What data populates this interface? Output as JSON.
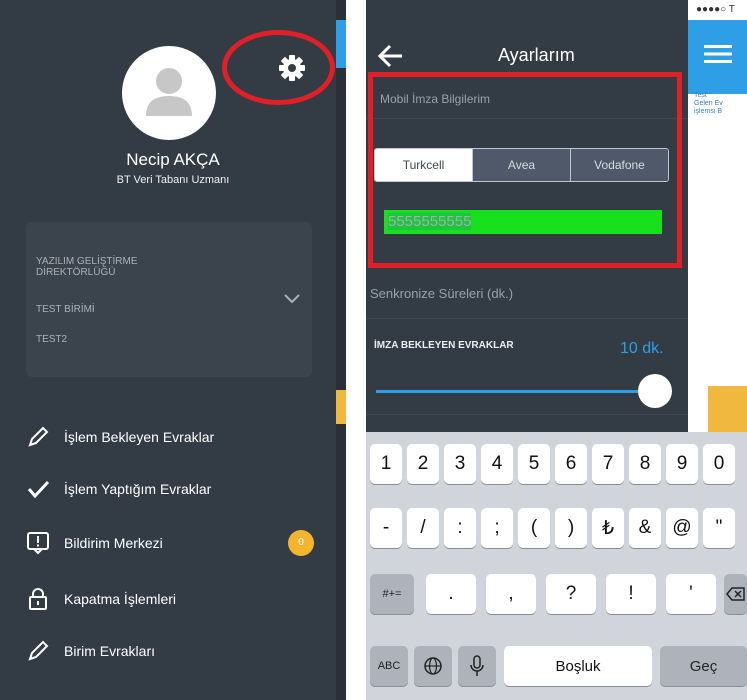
{
  "left_panel": {
    "user_name": "Necip AKÇA",
    "user_role": "BT Veri Tabanı Uzmanı",
    "units": [
      "YAZILIM GELİŞTİRME",
      "DİREKTÖRLÜĞÜ",
      "TEST BİRİMİ",
      "TEST2"
    ],
    "menu": [
      {
        "label": "İşlem Bekleyen Evraklar",
        "icon": "pencil-icon"
      },
      {
        "label": "İşlem Yaptığım Evraklar",
        "icon": "checkmark-icon"
      },
      {
        "label": "Bildirim Merkezi",
        "icon": "notification-icon"
      },
      {
        "label": "Kapatma İşlemleri",
        "icon": "lock-icon"
      },
      {
        "label": "Birim Evrakları",
        "icon": "pencil-icon"
      }
    ],
    "badge_count": "0"
  },
  "settings": {
    "title": "Ayarlarım",
    "mobile_sig_title": "Mobil İmza Bilgilerim",
    "operators": [
      "Turkcell",
      "Avea",
      "Vodafone"
    ],
    "phone_number": "5555555555",
    "sync_title": "Senkronize Süreleri (dk.)",
    "imza_label": "İMZA BEKLEYEN EVRAKLAR",
    "imza_value": "10 dk.",
    "imza_slider_level": 1.0
  },
  "right_strip": {
    "status": "●●●●○ T",
    "note_lines": [
      "Test",
      "Gelen Ev",
      "işlemsi B"
    ]
  },
  "keyboard": {
    "row1": [
      "1",
      "2",
      "3",
      "4",
      "5",
      "6",
      "7",
      "8",
      "9",
      "0"
    ],
    "row2": [
      "-",
      "/",
      ":",
      ";",
      "(",
      ")",
      "₺",
      "&",
      "@",
      "\""
    ],
    "row3_mode": "#+=",
    "row3": [
      ".",
      ",",
      "?",
      "!",
      "'"
    ],
    "abc": "ABC",
    "space": "Boşluk",
    "go": "Geç"
  },
  "colors": {
    "panel_bg": "#333c45",
    "accent_blue": "#2e9fe6",
    "highlight_red": "#e01f26",
    "phone_highlight": "#19e01d",
    "badge_yellow": "#f3b52c"
  }
}
